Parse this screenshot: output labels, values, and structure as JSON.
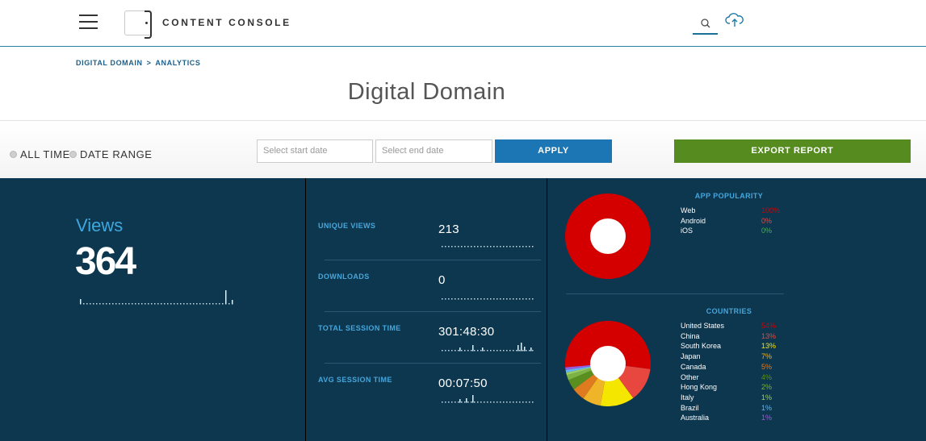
{
  "header": {
    "brand": "CONTENT CONSOLE"
  },
  "breadcrumb": {
    "items": [
      "DIGITAL DOMAIN",
      "ANALYTICS"
    ],
    "separator": ">"
  },
  "page": {
    "title": "Digital Domain"
  },
  "filters": {
    "all_time_label": "ALL TIME",
    "date_range_label": "DATE RANGE",
    "start_placeholder": "Select start date",
    "end_placeholder": "Select end date",
    "apply_label": "APPLY",
    "export_label": "EXPORT REPORT"
  },
  "summary": {
    "views_label": "Views",
    "views_value": "364"
  },
  "metrics": [
    {
      "label": "UNIQUE VIEWS",
      "value": "213"
    },
    {
      "label": "DOWNLOADS",
      "value": "0"
    },
    {
      "label": "TOTAL SESSION TIME",
      "value": "301:48:30"
    },
    {
      "label": "AVG SESSION TIME",
      "value": "00:07:50"
    }
  ],
  "app_popularity": {
    "title": "APP POPULARITY",
    "items": [
      {
        "name": "Web",
        "pct": "100%",
        "value": 100,
        "color": "#d40000"
      },
      {
        "name": "Android",
        "pct": "0%",
        "value": 0,
        "color": "#e8473f"
      },
      {
        "name": "iOS",
        "pct": "0%",
        "value": 0,
        "color": "#4caf50"
      }
    ]
  },
  "countries": {
    "title": "COUNTRIES",
    "items": [
      {
        "name": "United States",
        "pct": "54%",
        "value": 54,
        "color": "#d40000"
      },
      {
        "name": "China",
        "pct": "13%",
        "value": 13,
        "color": "#e8473f"
      },
      {
        "name": "South Korea",
        "pct": "13%",
        "value": 13,
        "color": "#f5e600"
      },
      {
        "name": "Japan",
        "pct": "7%",
        "value": 7,
        "color": "#f0b429"
      },
      {
        "name": "Canada",
        "pct": "5%",
        "value": 5,
        "color": "#e07a1f"
      },
      {
        "name": "Other",
        "pct": "4%",
        "value": 4,
        "color": "#5a8f1f"
      },
      {
        "name": "Hong Kong",
        "pct": "2%",
        "value": 2,
        "color": "#7cb342"
      },
      {
        "name": "Italy",
        "pct": "1%",
        "value": 1,
        "color": "#9ccc65"
      },
      {
        "name": "Brazil",
        "pct": "1%",
        "value": 1,
        "color": "#64b5f6"
      },
      {
        "name": "Australia",
        "pct": "1%",
        "value": 1,
        "color": "#9c5bd9"
      }
    ]
  }
}
